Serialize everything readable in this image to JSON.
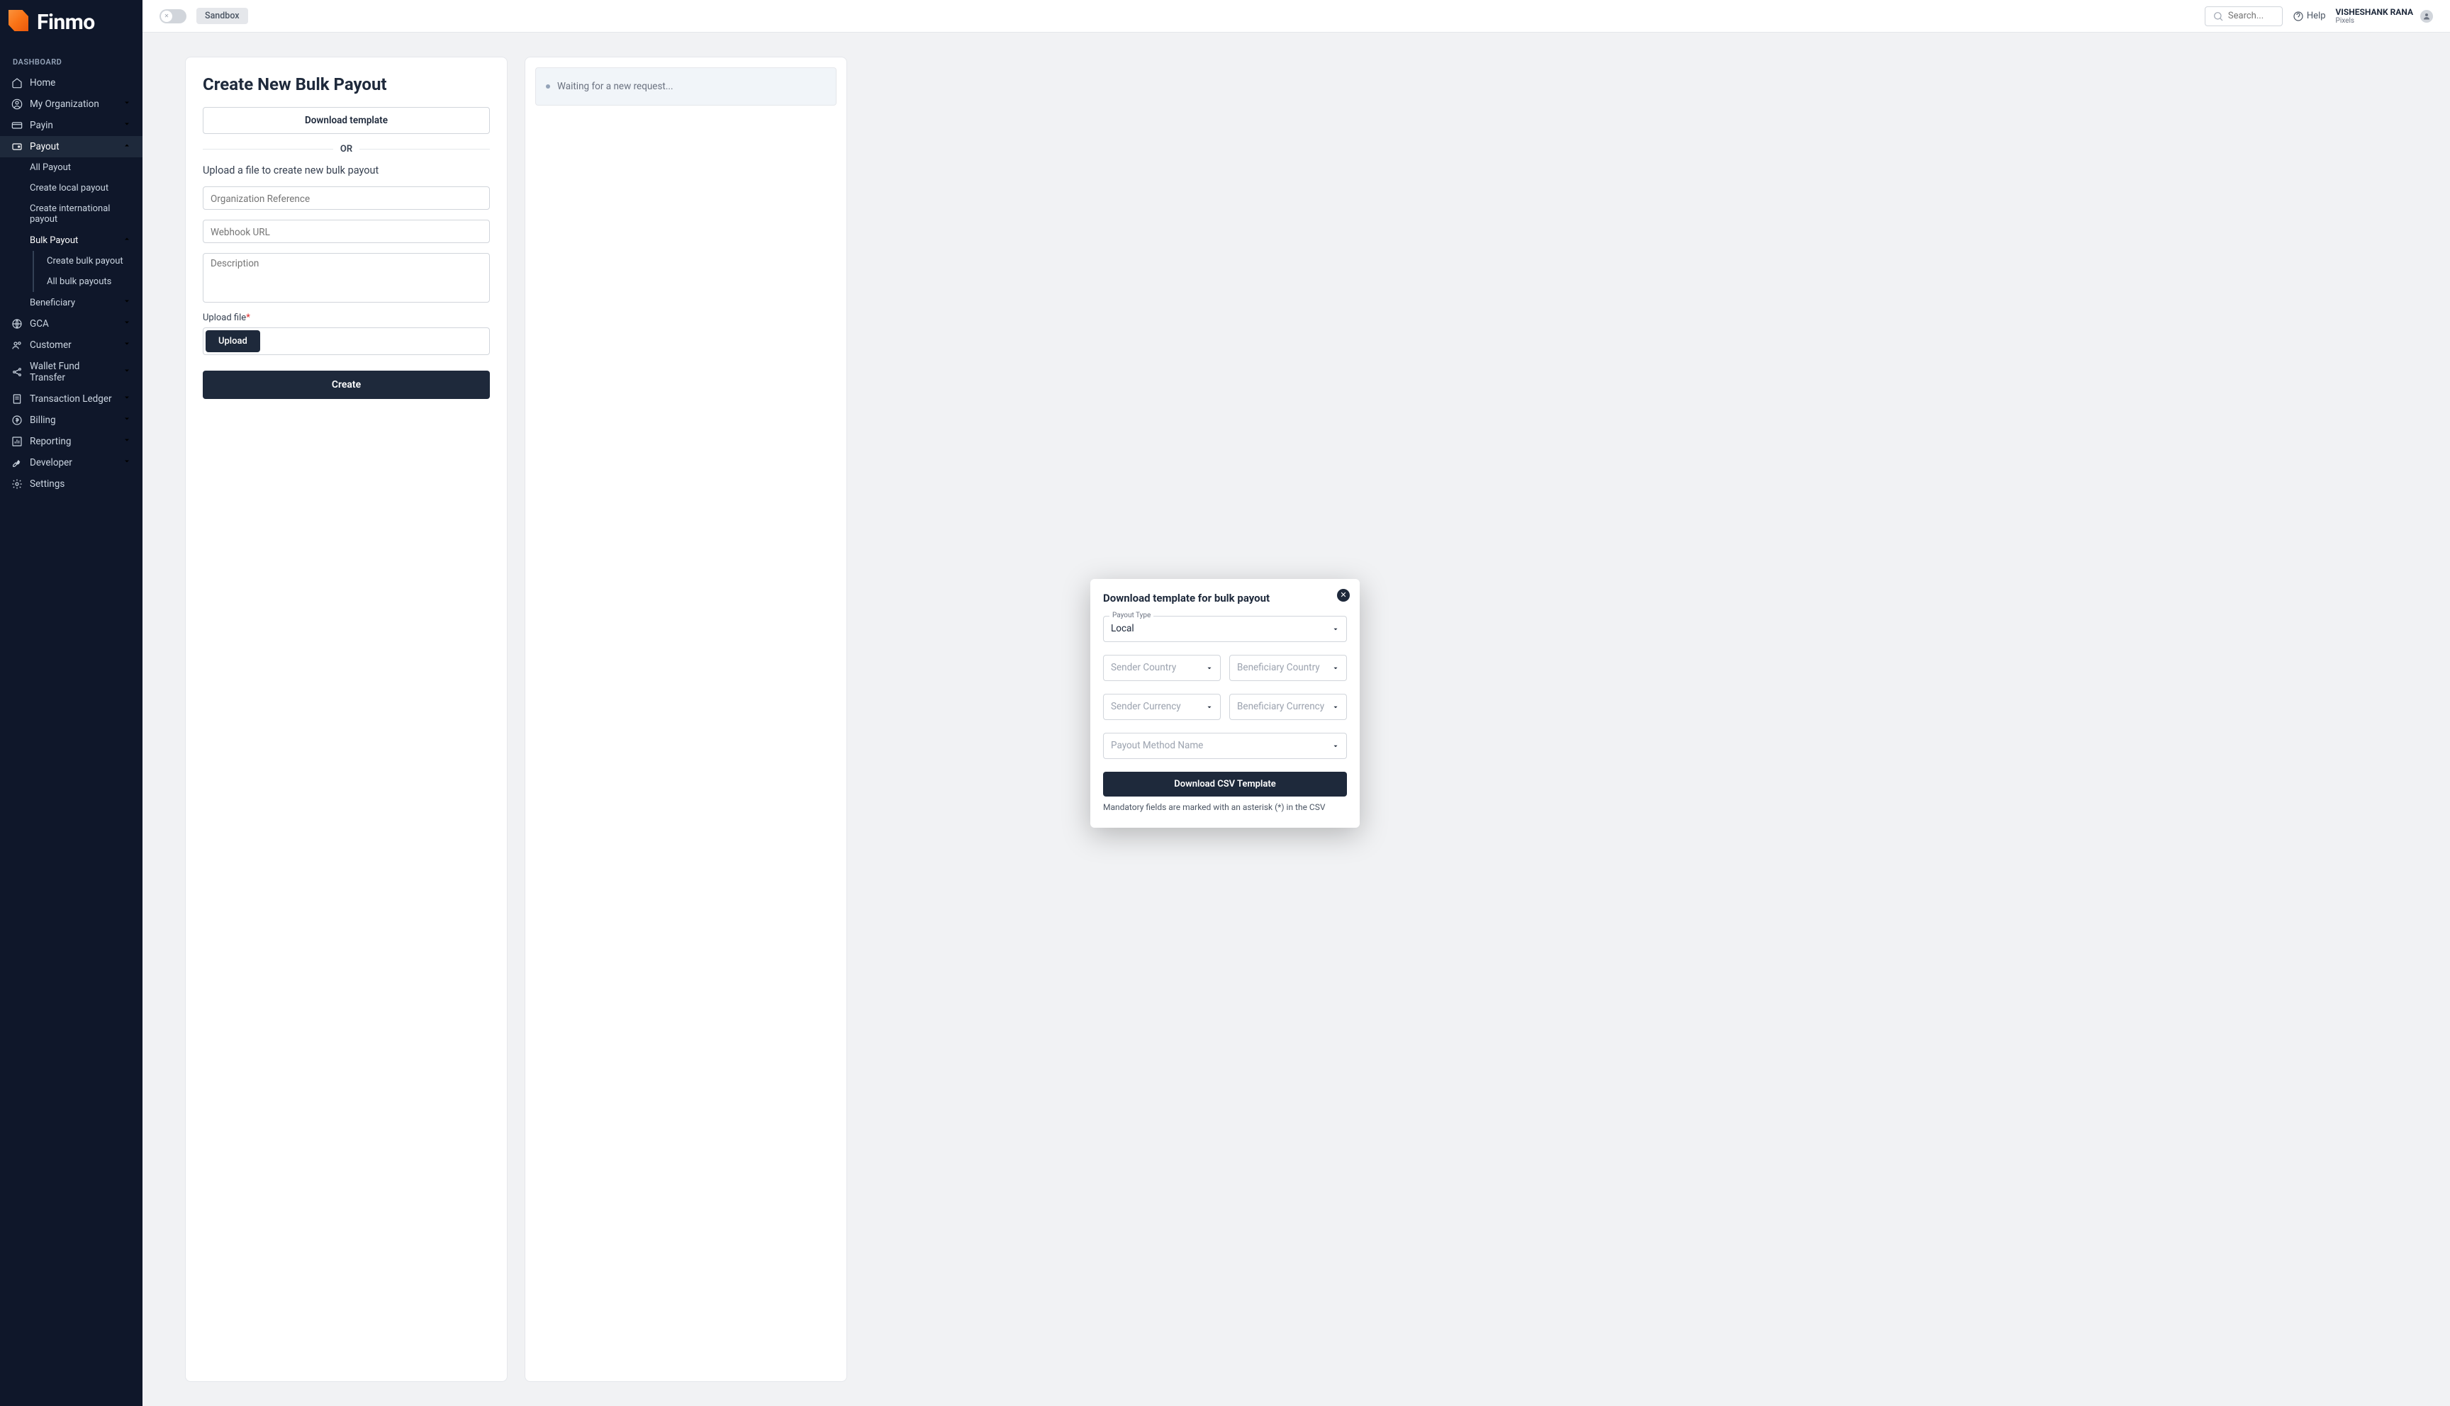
{
  "brand": {
    "name": "Finmo"
  },
  "topbar": {
    "mode_chip": "Sandbox",
    "search_placeholder": "Search...",
    "help_label": "Help",
    "user_name": "VISHESHANK RANA",
    "user_org": "Pixels"
  },
  "sidebar": {
    "section": "DASHBOARD",
    "items": [
      {
        "label": "Home"
      },
      {
        "label": "My Organization"
      },
      {
        "label": "Payin"
      },
      {
        "label": "Payout"
      },
      {
        "label": "GCA"
      },
      {
        "label": "Customer"
      },
      {
        "label": "Wallet Fund Transfer"
      },
      {
        "label": "Transaction Ledger"
      },
      {
        "label": "Billing"
      },
      {
        "label": "Reporting"
      },
      {
        "label": "Developer"
      },
      {
        "label": "Settings"
      }
    ],
    "payout_sub": [
      {
        "label": "All Payout"
      },
      {
        "label": "Create local payout"
      },
      {
        "label": "Create international payout"
      },
      {
        "label": "Bulk Payout"
      },
      {
        "label": "Beneficiary"
      }
    ],
    "bulk_sub": [
      {
        "label": "Create bulk payout"
      },
      {
        "label": "All bulk payouts"
      }
    ]
  },
  "form": {
    "title": "Create New Bulk Payout",
    "download_template": "Download template",
    "or": "OR",
    "subtitle": "Upload a file to create new bulk payout",
    "org_ref": "Organization Reference",
    "webhook": "Webhook URL",
    "description": "Description",
    "upload_label": "Upload file",
    "upload_btn": "Upload",
    "create_btn": "Create"
  },
  "status": {
    "waiting": "Waiting for a new request..."
  },
  "modal": {
    "title": "Download template for bulk payout",
    "payout_type_label": "Payout Type",
    "payout_type_value": "Local",
    "sender_country": "Sender Country",
    "beneficiary_country": "Beneficiary Country",
    "sender_currency": "Sender Currency",
    "beneficiary_currency": "Beneficiary Currency",
    "payout_method": "Payout Method Name",
    "download_btn": "Download CSV Template",
    "note": "Mandatory fields are marked with an asterisk (*) in the CSV"
  }
}
